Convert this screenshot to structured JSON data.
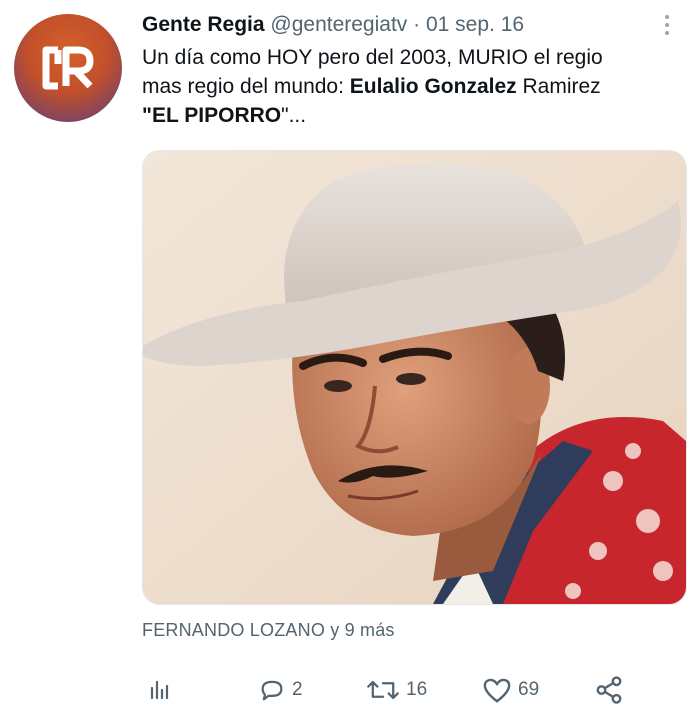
{
  "tweet": {
    "author_name": "Gente Regia",
    "handle": "@genteregiatv",
    "separator": "·",
    "date": "01 sep. 16",
    "avatar_label": "GR",
    "text_line1": "Un día como HOY pero del 2003, MURIO el regio",
    "text_line2_a": "mas regio del mundo: ",
    "text_line2_bold": "Eulalio Gonzalez",
    "text_line2_b": " Ramirez",
    "text_line3_q1": "\"",
    "text_line3_bold": "EL PIPORRO",
    "text_line3_q2": "\"...",
    "tagged": "FERNANDO LOZANO y 9 más"
  },
  "actions": {
    "reply_count": "2",
    "retweet_count": "16",
    "like_count": "69"
  },
  "icons": {
    "more": "more-vertical-icon",
    "analytics": "analytics-icon",
    "reply": "reply-icon",
    "retweet": "retweet-icon",
    "like": "heart-icon",
    "share": "share-icon"
  },
  "colors": {
    "text": "#0f1419",
    "secondary": "#536471",
    "avatar_orange": "#c2502a",
    "avatar_purple": "#4a3f86"
  }
}
